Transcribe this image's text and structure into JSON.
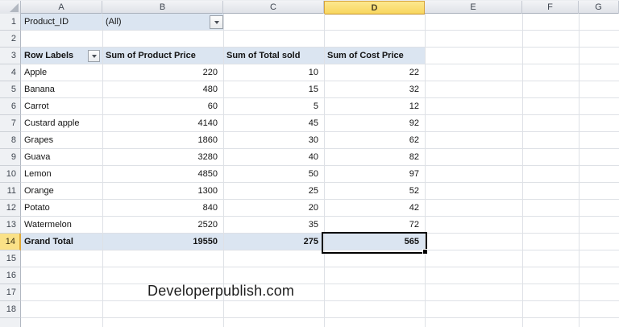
{
  "columns": [
    "A",
    "B",
    "C",
    "D",
    "E",
    "F",
    "G"
  ],
  "row_numbers": [
    "1",
    "2",
    "3",
    "4",
    "5",
    "6",
    "7",
    "8",
    "9",
    "10",
    "11",
    "12",
    "13",
    "14",
    "15",
    "16",
    "17",
    "18"
  ],
  "selection": {
    "cell": "D14",
    "selected_column": "D",
    "selected_row": "14"
  },
  "filter_row": {
    "label": "Product_ID",
    "value": "(All)"
  },
  "pivot": {
    "header": {
      "row_labels": "Row Labels",
      "col1": "Sum of Product Price",
      "col2": "Sum of Total sold",
      "col3": "Sum of Cost Price"
    },
    "rows": [
      {
        "label": "Apple",
        "v1": "220",
        "v2": "10",
        "v3": "22"
      },
      {
        "label": "Banana",
        "v1": "480",
        "v2": "15",
        "v3": "32"
      },
      {
        "label": "Carrot",
        "v1": "60",
        "v2": "5",
        "v3": "12"
      },
      {
        "label": "Custard apple",
        "v1": "4140",
        "v2": "45",
        "v3": "92"
      },
      {
        "label": "Grapes",
        "v1": "1860",
        "v2": "30",
        "v3": "62"
      },
      {
        "label": "Guava",
        "v1": "3280",
        "v2": "40",
        "v3": "82"
      },
      {
        "label": "Lemon",
        "v1": "4850",
        "v2": "50",
        "v3": "97"
      },
      {
        "label": "Orange",
        "v1": "1300",
        "v2": "25",
        "v3": "52"
      },
      {
        "label": "Potato",
        "v1": "840",
        "v2": "20",
        "v3": "42"
      },
      {
        "label": "Watermelon",
        "v1": "2520",
        "v2": "35",
        "v3": "72"
      }
    ],
    "total": {
      "label": "Grand Total",
      "v1": "19550",
      "v2": "275",
      "v3": "565"
    }
  },
  "watermark": "Developerpublish.com",
  "colors": {
    "pivot_band_fill": "#dbe5f1",
    "selected_header_fill": "#f8d65e",
    "selected_header_border": "#d7a43c",
    "gridline": "#dee1e6",
    "header_strip": "#e4e7ee"
  }
}
